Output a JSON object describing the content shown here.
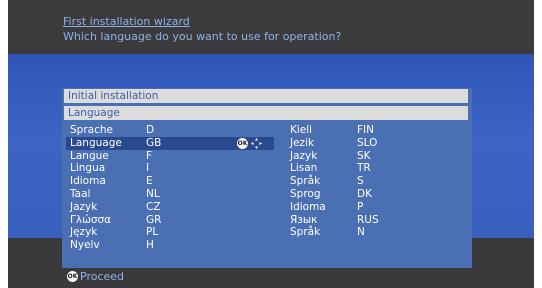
{
  "wizard": {
    "title": "First installation wizard",
    "question": "Which language do you want to use for operation?"
  },
  "panel": {
    "header": "Initial installation",
    "subheader": "Language"
  },
  "languages_left": [
    {
      "name": "Sprache",
      "code": "D"
    },
    {
      "name": "Language",
      "code": "GB",
      "selected": true
    },
    {
      "name": "Langue",
      "code": "F"
    },
    {
      "name": "Lingua",
      "code": "I"
    },
    {
      "name": "Idioma",
      "code": "E"
    },
    {
      "name": "Taal",
      "code": "NL"
    },
    {
      "name": "Jazyk",
      "code": "CZ"
    },
    {
      "name": "Γλώσσα",
      "code": "GR"
    },
    {
      "name": "Język",
      "code": "PL"
    },
    {
      "name": "Nyelv",
      "code": "H"
    }
  ],
  "languages_right": [
    {
      "name": "Kieli",
      "code": "FIN"
    },
    {
      "name": "Jezik",
      "code": "SLO"
    },
    {
      "name": "Jazyk",
      "code": "SK"
    },
    {
      "name": "Lisan",
      "code": "TR"
    },
    {
      "name": "Språk",
      "code": "S"
    },
    {
      "name": "Sprog",
      "code": "DK"
    },
    {
      "name": "Idioma",
      "code": "P"
    },
    {
      "name": "Язык",
      "code": "RUS"
    },
    {
      "name": "Språk",
      "code": "N"
    }
  ],
  "ok_badge": "OK",
  "footer": {
    "ok_badge": "OK",
    "proceed_label": "Proceed"
  },
  "icons": {
    "ok": "ok-button-icon",
    "navigate": "navigation-arrows-icon"
  },
  "colors": {
    "accent_text": "#8fb2e8",
    "panel_blue": "#4a6fb3",
    "selection": "#2a4a8f",
    "background_blue": "#3a60bf"
  }
}
